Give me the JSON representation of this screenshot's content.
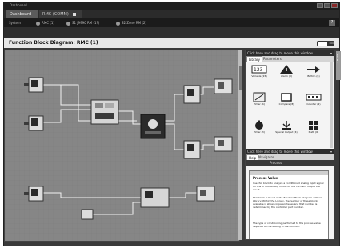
{
  "window": {
    "title": "Dashboard"
  },
  "tabs": [
    {
      "label": "Dashboard"
    },
    {
      "label": "RMC (COMM)"
    }
  ],
  "system": {
    "label": "System",
    "items": [
      {
        "label": "RMC (1)"
      },
      {
        "label": "S1 J9990 RM (1?)"
      },
      {
        "label": "S2 Zone RM (2)"
      }
    ],
    "help": "?"
  },
  "diagram": {
    "title": "Function Block Diagram: RMC (1)",
    "toggle_text": "100"
  },
  "library_panel": {
    "header": "Click here and drag to move this window",
    "tabs": [
      "Library",
      "Parameters"
    ],
    "items": [
      {
        "label": "Variable (15)",
        "icon": "variable-icon"
      },
      {
        "label": "Alarm (3)",
        "icon": "alarm-icon"
      },
      {
        "label": "Button (6)",
        "icon": "button-icon"
      },
      {
        "label": "Timer (4)",
        "icon": "timer-icon"
      },
      {
        "label": "Compare (8)",
        "icon": "compare-icon"
      },
      {
        "label": "Counter (2)",
        "icon": "counter-icon"
      },
      {
        "label": "Timer (3)",
        "icon": "stopwatch-icon"
      },
      {
        "label": "Special Output (4)",
        "icon": "special-output-icon"
      },
      {
        "label": "Math (6)",
        "icon": "math-icon"
      }
    ]
  },
  "help_panel": {
    "header": "Click here and drag to move this window",
    "tabs": [
      "Help",
      "Navigator"
    ],
    "section": "Process",
    "title": "Process Value",
    "paragraphs": [
      "Use this block to analyze a conditioned analog input signal on one of four analog inputs on the card and output the result.",
      "This block is found in the Function Block Diagram editor's Library. Within the Library, the number of these blocks available is shown in parentheses and that number is determined by the controller part number.",
      "The type of conditioning performed to the process value depends on the setting of the Function."
    ]
  },
  "sidetab": {
    "label": "Library"
  },
  "colors": {
    "canvas": "#868686",
    "chrome": "#2b2b2b",
    "panel": "#f4f4f4"
  }
}
